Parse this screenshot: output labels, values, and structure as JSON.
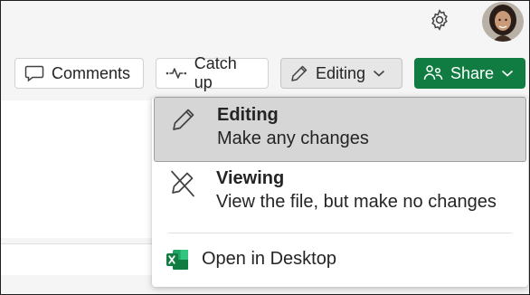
{
  "header": {
    "settings_icon": "gear-icon",
    "avatar_icon": "user-avatar"
  },
  "toolbar": {
    "comments_label": "Comments",
    "catchup_label": "Catch up",
    "editing_label": "Editing",
    "share_label": "Share"
  },
  "menu": {
    "items": [
      {
        "icon": "pencil-icon",
        "title": "Editing",
        "description": "Make any changes",
        "selected": true
      },
      {
        "icon": "pencil-off-icon",
        "title": "Viewing",
        "description": "View the file, but make no changes",
        "selected": false
      }
    ],
    "open_desktop": {
      "icon": "excel-icon",
      "label": "Open in Desktop"
    }
  },
  "colors": {
    "share_green": "#107c41",
    "excel_green": "#107c41",
    "selected_bg": "#d6d6d6"
  }
}
